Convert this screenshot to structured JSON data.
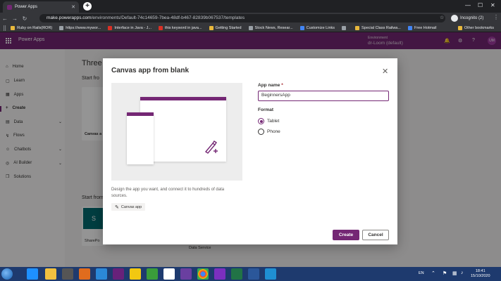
{
  "browser": {
    "tab_title": "Power Apps",
    "url_domain": "make.powerapps.com",
    "url_path": "/environments/Default-74c14659-7bea-48df-b467-82839b067537/templates",
    "profile_label": "Incognito (2)",
    "bookmarks": [
      {
        "label": "Ruby on Rails(ROR)",
        "color": "#e8b83c"
      },
      {
        "label": "https://www.mywor...",
        "color": "#9aa0a6"
      },
      {
        "label": "Interface in Java - J...",
        "color": "#d93025"
      },
      {
        "label": "this keyword in java...",
        "color": "#d93025"
      },
      {
        "label": "Getting Started",
        "color": "#e8b83c"
      },
      {
        "label": "Stock News, Resear...",
        "color": "#9aa0a6"
      },
      {
        "label": "Customize Links",
        "color": "#4285f4"
      },
      {
        "label": "",
        "color": "#9aa0a6"
      },
      {
        "label": "Special Class Railwa...",
        "color": "#e8b83c"
      },
      {
        "label": "Free Hotmail",
        "color": "#4285f4"
      }
    ],
    "other_bookmarks": "Other bookmarks"
  },
  "powerapps": {
    "app_title": "Power Apps",
    "environment_label": "Environment",
    "environment_name": "dr-Loom (default)",
    "avatar_initials": "UM",
    "nav": [
      {
        "label": "Home",
        "chevron": false,
        "active": false
      },
      {
        "label": "Learn",
        "chevron": false,
        "active": false
      },
      {
        "label": "Apps",
        "chevron": false,
        "active": false
      },
      {
        "label": "Create",
        "chevron": false,
        "active": true
      },
      {
        "label": "Data",
        "chevron": true,
        "active": false
      },
      {
        "label": "Flows",
        "chevron": false,
        "active": false
      },
      {
        "label": "Chatbots",
        "chevron": true,
        "active": false
      },
      {
        "label": "AI Builder",
        "chevron": true,
        "active": false
      },
      {
        "label": "Solutions",
        "chevron": false,
        "active": false
      }
    ],
    "main_title": "Three w",
    "start_from_blank": "Start fro",
    "start_from_data": "Start from",
    "tile_label_1": "Canvas a",
    "tile_label_2": "SharePo",
    "bottom_label": "Data Service"
  },
  "dialog": {
    "title": "Canvas app from blank",
    "description": "Design the app you want, and connect it to hundreds of data sources.",
    "chip_label": "Canvas app",
    "app_name_label": "App name",
    "required_mark": "*",
    "app_name_value": "BeginnersApp",
    "format_label": "Format",
    "formats": [
      {
        "label": "Tablet",
        "selected": true
      },
      {
        "label": "Phone",
        "selected": false
      }
    ],
    "create_label": "Create",
    "cancel_label": "Cancel"
  },
  "taskbar": {
    "language": "EN",
    "time": "18:41",
    "date": "15/10/2020"
  },
  "colors": {
    "brand": "#742774",
    "taskbar": "#1e3a6e"
  }
}
